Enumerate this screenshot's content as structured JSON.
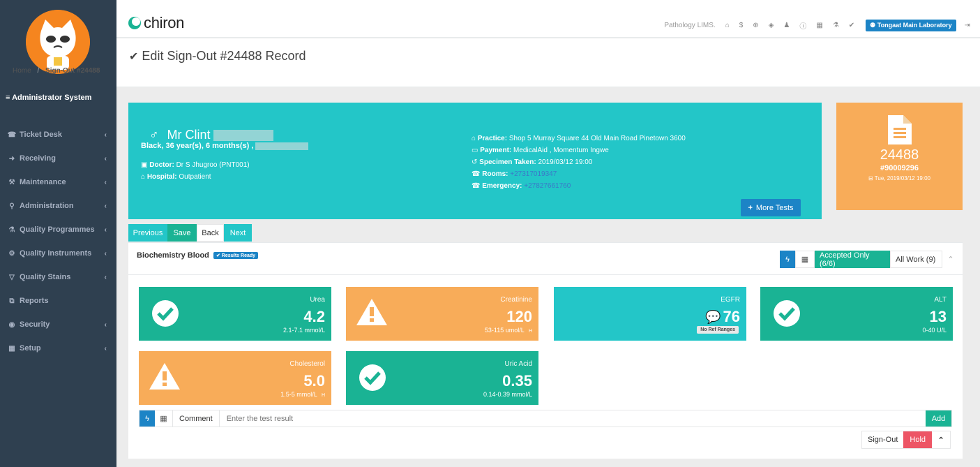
{
  "user": {
    "name": "Administrator System"
  },
  "sidebar": {
    "items": [
      {
        "label": "Ticket Desk",
        "icon": "phone-icon",
        "chevron": true
      },
      {
        "label": "Receiving",
        "icon": "arrow-right-icon",
        "chevron": true
      },
      {
        "label": "Maintenance",
        "icon": "wrench-icon",
        "chevron": true
      },
      {
        "label": "Administration",
        "icon": "map-pin-icon",
        "chevron": true
      },
      {
        "label": "Quality Programmes",
        "icon": "flask-icon",
        "chevron": true
      },
      {
        "label": "Quality Instruments",
        "icon": "gear-icon",
        "chevron": true
      },
      {
        "label": "Quality Stains",
        "icon": "beaker-icon",
        "chevron": true
      },
      {
        "label": "Reports",
        "icon": "copy-icon",
        "chevron": false
      },
      {
        "label": "Security",
        "icon": "eye-icon",
        "chevron": true
      },
      {
        "label": "Setup",
        "icon": "grid-icon",
        "chevron": true
      }
    ]
  },
  "topbar": {
    "logo": "chiron",
    "app_name": "Pathology LIMS.",
    "lab": "Tongaat Main Laboratory"
  },
  "page": {
    "title": "Edit Sign-Out #24488 Record",
    "breadcrumb_home": "Home",
    "breadcrumb_sep": "/",
    "breadcrumb_current": "Sign-Out #24488"
  },
  "patient": {
    "name": "Mr Clint",
    "details": "Black, 36 year(s), 6 months(s) ,",
    "doctor_label": "Doctor:",
    "doctor": "Dr S Jhugroo (PNT001)",
    "hospital_label": "Hospital:",
    "hospital": "Outpatient",
    "practice_label": "Practice:",
    "practice": "Shop 5 Murray Square 44 Old Main Road Pinetown 3600",
    "payment_label": "Payment:",
    "payment": "MedicalAid , Momentum Ingwe",
    "specimen_label": "Specimen Taken:",
    "specimen": "2019/03/12 19:00",
    "rooms_label": "Rooms:",
    "rooms": "+27317019347",
    "emergency_label": "Emergency:",
    "emergency": "+27827661760",
    "more_tests": "More Tests"
  },
  "record": {
    "number": "24488",
    "barcode": "#90009296",
    "date": "Tue, 2019/03/12 19:00"
  },
  "nav_buttons": {
    "previous": "Previous",
    "save": "Save",
    "back": "Back",
    "next": "Next"
  },
  "panel": {
    "title": "Biochemistry Blood",
    "badge": "Results Ready",
    "accepted": "Accepted Only (6/6)",
    "all_work": "All Work (9)"
  },
  "results": [
    {
      "name": "Urea",
      "value": "4.2",
      "range": "2.1-7.1 mmol/L",
      "flag": "",
      "status": "ok"
    },
    {
      "name": "Creatinine",
      "value": "120",
      "range": "53-115 umol/L",
      "flag": "H",
      "status": "warn"
    },
    {
      "name": "EGFR",
      "value": "76",
      "range": "No Ref Ranges",
      "flag": "",
      "status": "info"
    },
    {
      "name": "ALT",
      "value": "13",
      "range": "0-40 U/L",
      "flag": "",
      "status": "ok"
    },
    {
      "name": "Cholesterol",
      "value": "5.0",
      "range": "1.5-5 mmol/L",
      "flag": "H",
      "status": "warn"
    },
    {
      "name": "Uric Acid",
      "value": "0.35",
      "range": "0.14-0.39 mmol/L",
      "flag": "",
      "status": "ok"
    }
  ],
  "comment": {
    "label": "Comment",
    "placeholder": "Enter the test result",
    "add": "Add"
  },
  "actions": {
    "sign_out": "Sign-Out",
    "hold": "Hold"
  },
  "colors": {
    "sidebar": "#2f4050",
    "teal": "#23c6c8",
    "green": "#1ab394",
    "orange": "#f8ac59",
    "blue": "#1c84c6",
    "red": "#ed5565"
  }
}
